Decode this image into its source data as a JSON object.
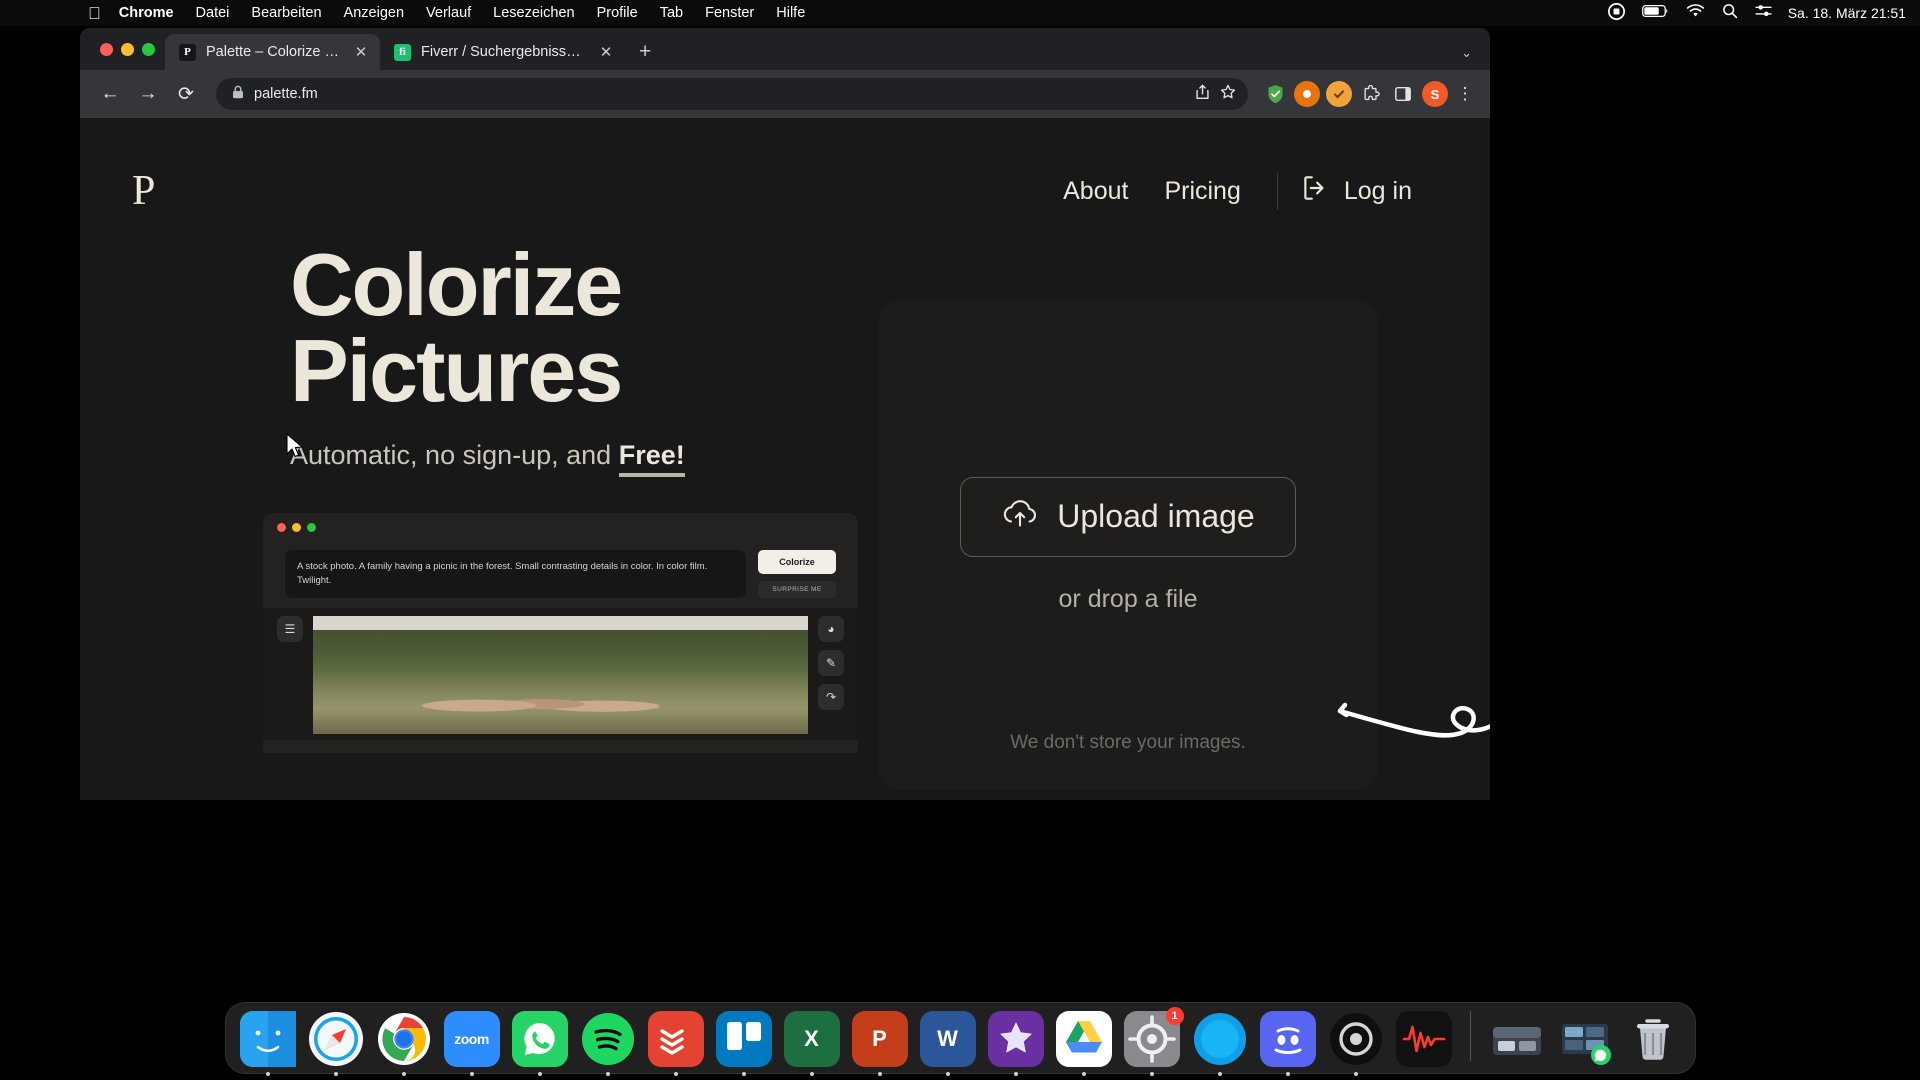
{
  "menubar": {
    "apple_icon": "apple-icon",
    "items": [
      "Chrome",
      "Datei",
      "Bearbeiten",
      "Anzeigen",
      "Verlauf",
      "Lesezeichen",
      "Profile",
      "Tab",
      "Fenster",
      "Hilfe"
    ],
    "tray_icons": [
      "screen-record-icon",
      "battery-icon",
      "wifi-icon",
      "search-icon",
      "control-center-icon"
    ],
    "clock": "Sa. 18. März  21:51"
  },
  "browser": {
    "tabs": [
      {
        "favicon": "P",
        "title": "Palette – Colorize Photos",
        "close": "✕",
        "active": true
      },
      {
        "favicon": "fi",
        "title": "Fiverr / Suchergebnisse für „bl",
        "close": "✕",
        "active": false
      }
    ],
    "new_tab_label": "+",
    "tab_list_chevron": "⌄",
    "nav": {
      "back": "←",
      "forward": "→",
      "reload": "⟳"
    },
    "omnibox": {
      "lock_icon": "lock-icon",
      "url": "palette.fm",
      "share_icon": "share-icon",
      "bookmark_icon": "star-icon"
    },
    "extensions": [
      "shield-icon",
      "extension-orange-icon",
      "extension-amber-icon",
      "puzzle-icon",
      "side-panel-icon"
    ],
    "profile_avatar": "S",
    "menu_icon": "⋮"
  },
  "site": {
    "logo": "P",
    "nav": {
      "about": "About",
      "pricing": "Pricing",
      "login": "Log in",
      "login_icon": "login-arrow-icon"
    },
    "hero": {
      "title_line1": "Colorize",
      "title_line2": "Pictures",
      "subtitle_prefix": "Automatic, no sign-up, and ",
      "subtitle_emphasis": "Free!"
    },
    "preview": {
      "prompt": "A stock photo. A family having a picnic in the forest. Small contrasting details in color. In color film. Twilight.",
      "colorize_button": "Colorize",
      "surprise_button": "SURPRISE ME",
      "menu_icon": "hamburger-icon",
      "palette_icon": "palette-icon",
      "edit_icon": "pencil-icon",
      "undo_icon": "undo-icon"
    },
    "upload": {
      "button_label": "Upload image",
      "upload_icon": "cloud-upload-icon",
      "drop_label": "or drop a file",
      "privacy_note": "We don't store your images."
    }
  },
  "dock": {
    "apps": [
      {
        "name": "finder",
        "label": "",
        "color": "#1e9bf0",
        "running": true
      },
      {
        "name": "safari",
        "label": "",
        "color": "#e8f4fd",
        "running": true
      },
      {
        "name": "chrome",
        "label": "",
        "color": "#ffffff",
        "running": true
      },
      {
        "name": "zoom",
        "label": "zoom",
        "color": "#2d8cff",
        "running": true
      },
      {
        "name": "whatsapp",
        "label": "",
        "color": "#25d366",
        "running": true
      },
      {
        "name": "spotify",
        "label": "",
        "color": "#191414",
        "running": true
      },
      {
        "name": "todoist",
        "label": "",
        "color": "#e44332",
        "running": true
      },
      {
        "name": "trello",
        "label": "",
        "color": "#0079bf",
        "running": true
      },
      {
        "name": "excel",
        "label": "X",
        "color": "#1d6f42",
        "running": true
      },
      {
        "name": "powerpoint",
        "label": "P",
        "color": "#c43e1c",
        "running": true
      },
      {
        "name": "word",
        "label": "W",
        "color": "#2b579a",
        "running": true
      },
      {
        "name": "imovie",
        "label": "",
        "color": "#7b3fa0",
        "running": true
      },
      {
        "name": "google-drive",
        "label": "",
        "color": "#ffffff",
        "running": true
      },
      {
        "name": "system-settings",
        "label": "",
        "color": "#8e8e93",
        "running": true,
        "badge": "1"
      },
      {
        "name": "messenger-blue",
        "label": "",
        "color": "#0b9ee8",
        "running": true
      },
      {
        "name": "discord",
        "label": "",
        "color": "#5865f2",
        "running": true
      },
      {
        "name": "cleanmymac",
        "label": "",
        "color": "#141414",
        "running": true
      },
      {
        "name": "audio-hijack",
        "label": "",
        "color": "#1b1b1b",
        "running": true
      }
    ],
    "files": [
      {
        "name": "downloads-stack",
        "label": ""
      },
      {
        "name": "folder-stack",
        "label": ""
      },
      {
        "name": "trash",
        "label": ""
      }
    ]
  }
}
